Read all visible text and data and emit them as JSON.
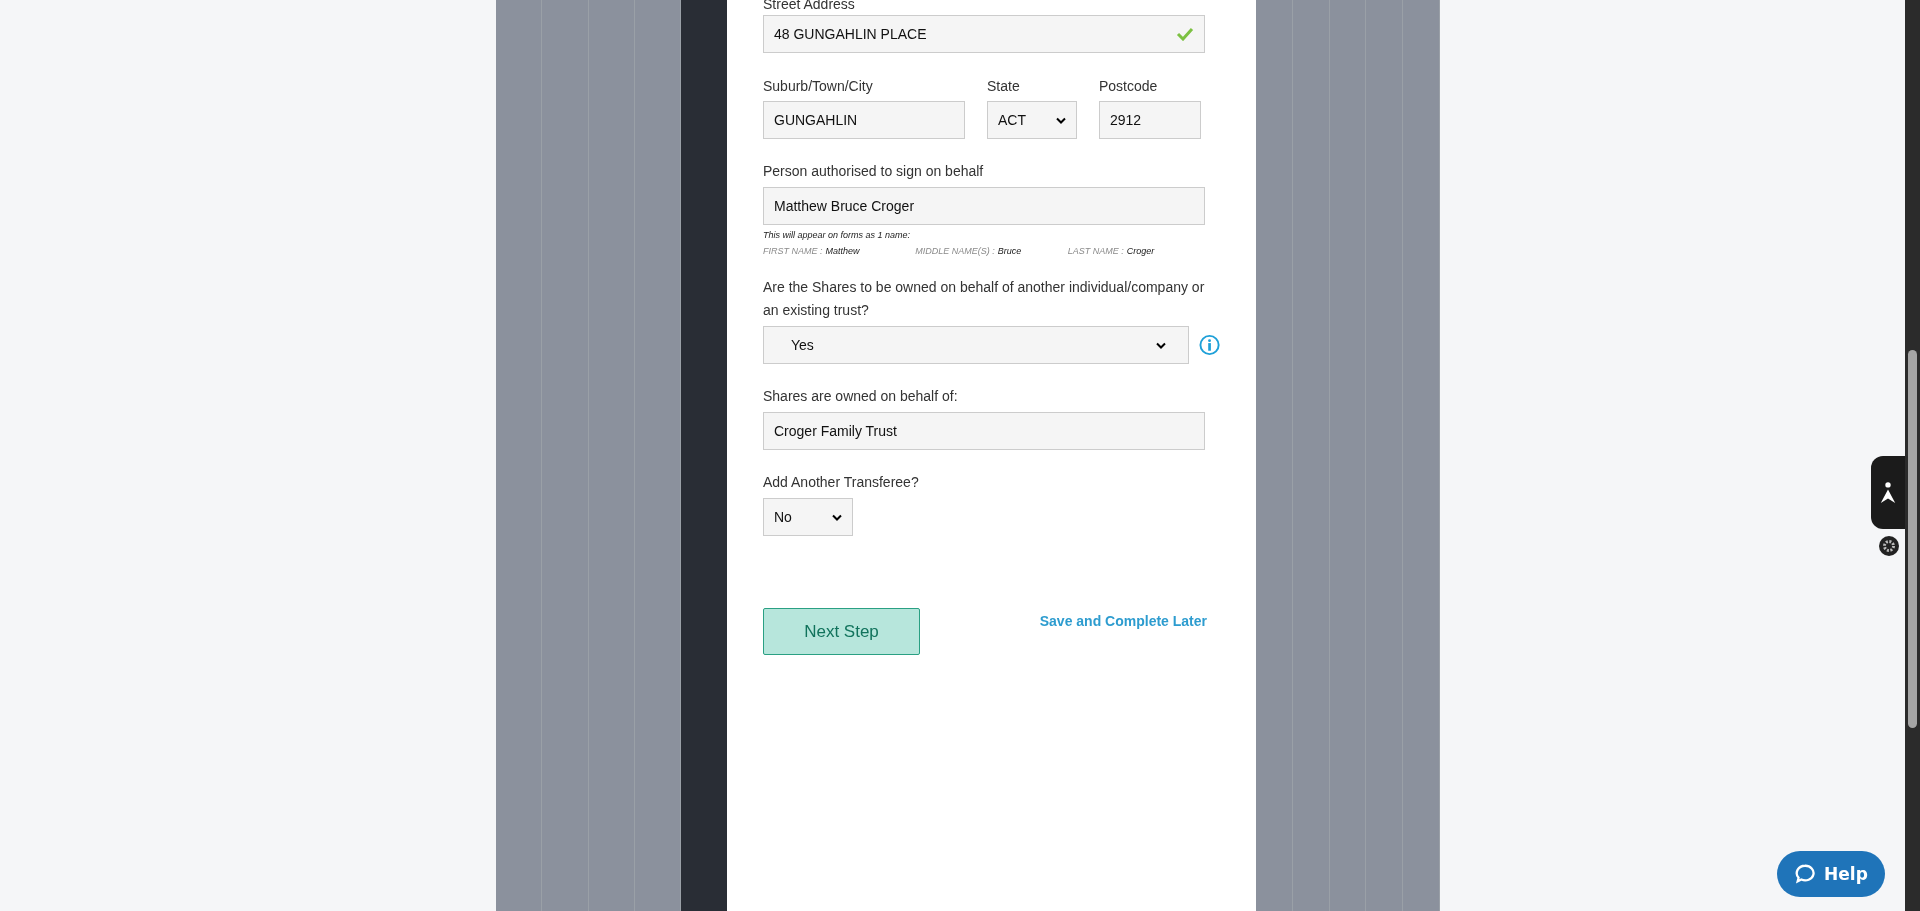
{
  "street_address": {
    "label": "Street Address",
    "value": "48 GUNGAHLIN PLACE",
    "valid": true
  },
  "suburb": {
    "label": "Suburb/Town/City",
    "value": "GUNGAHLIN"
  },
  "state": {
    "label": "State",
    "value": "ACT"
  },
  "postcode": {
    "label": "Postcode",
    "value": "2912"
  },
  "signatory": {
    "label": "Person authorised to sign on behalf",
    "value": "Matthew Bruce Croger",
    "note": "This will appear on forms as 1 name:",
    "parts": [
      {
        "label": "FIRST NAME :",
        "value": "Matthew"
      },
      {
        "label": "MIDDLE NAME(S) :",
        "value": "Bruce"
      },
      {
        "label": "LAST NAME :",
        "value": "Croger"
      }
    ]
  },
  "on_behalf": {
    "label": "Are the Shares to be owned on behalf of another individual/company or an existing trust?",
    "value": "Yes"
  },
  "owned_for": {
    "label": "Shares are owned on behalf of:",
    "value": "Croger Family Trust"
  },
  "another": {
    "label": "Add Another Transferee?",
    "value": "No"
  },
  "next_button": "Next Step",
  "save_link": "Save and Complete Later",
  "help_button": "Help"
}
